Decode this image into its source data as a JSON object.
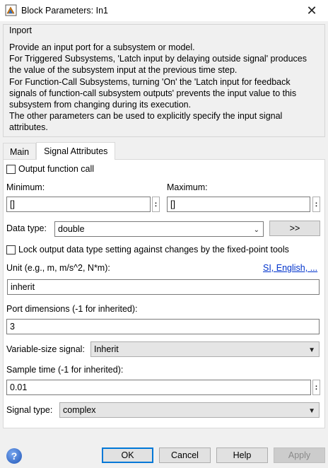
{
  "window": {
    "title": "Block Parameters: In1"
  },
  "group": {
    "title": "Inport",
    "description_lines": [
      "Provide an input port for a subsystem or model.",
      "For Triggered Subsystems, 'Latch input by delaying outside signal' produces",
      "the value of the subsystem input at the previous time step.",
      "For Function-Call Subsystems, turning 'On' the 'Latch input for feedback",
      "signals of function-call subsystem outputs' prevents the input value to this",
      "subsystem from changing during its execution.",
      "The other parameters can be used to explicitly specify the input signal",
      "attributes."
    ]
  },
  "tabs": [
    {
      "label": "Main",
      "active": false
    },
    {
      "label": "Signal Attributes",
      "active": true
    }
  ],
  "form": {
    "output_function_call": {
      "label": "Output function call",
      "checked": false
    },
    "minimum": {
      "label": "Minimum:",
      "value": "[]"
    },
    "maximum": {
      "label": "Maximum:",
      "value": "[]"
    },
    "dots": ":",
    "data_type": {
      "label": "Data type:",
      "value": "double",
      "expand_label": ">>"
    },
    "lock_output": {
      "label": "Lock output data type setting against changes by the fixed-point tools",
      "checked": false
    },
    "unit": {
      "label": "Unit (e.g., m, m/s^2, N*m):",
      "link": "SI, English, ...",
      "value": "inherit"
    },
    "port_dimensions": {
      "label": "Port dimensions (-1 for inherited):",
      "value": "3"
    },
    "variable_size": {
      "label": "Variable-size signal:",
      "value": "Inherit"
    },
    "sample_time": {
      "label": "Sample time (-1 for inherited):",
      "value": "0.01"
    },
    "signal_type": {
      "label": "Signal type:",
      "value": "complex"
    }
  },
  "buttons": {
    "ok": "OK",
    "cancel": "Cancel",
    "help": "Help",
    "apply": "Apply",
    "help_icon": "?"
  },
  "colors": {
    "accent": "#0078d7",
    "link": "#0033cc"
  }
}
